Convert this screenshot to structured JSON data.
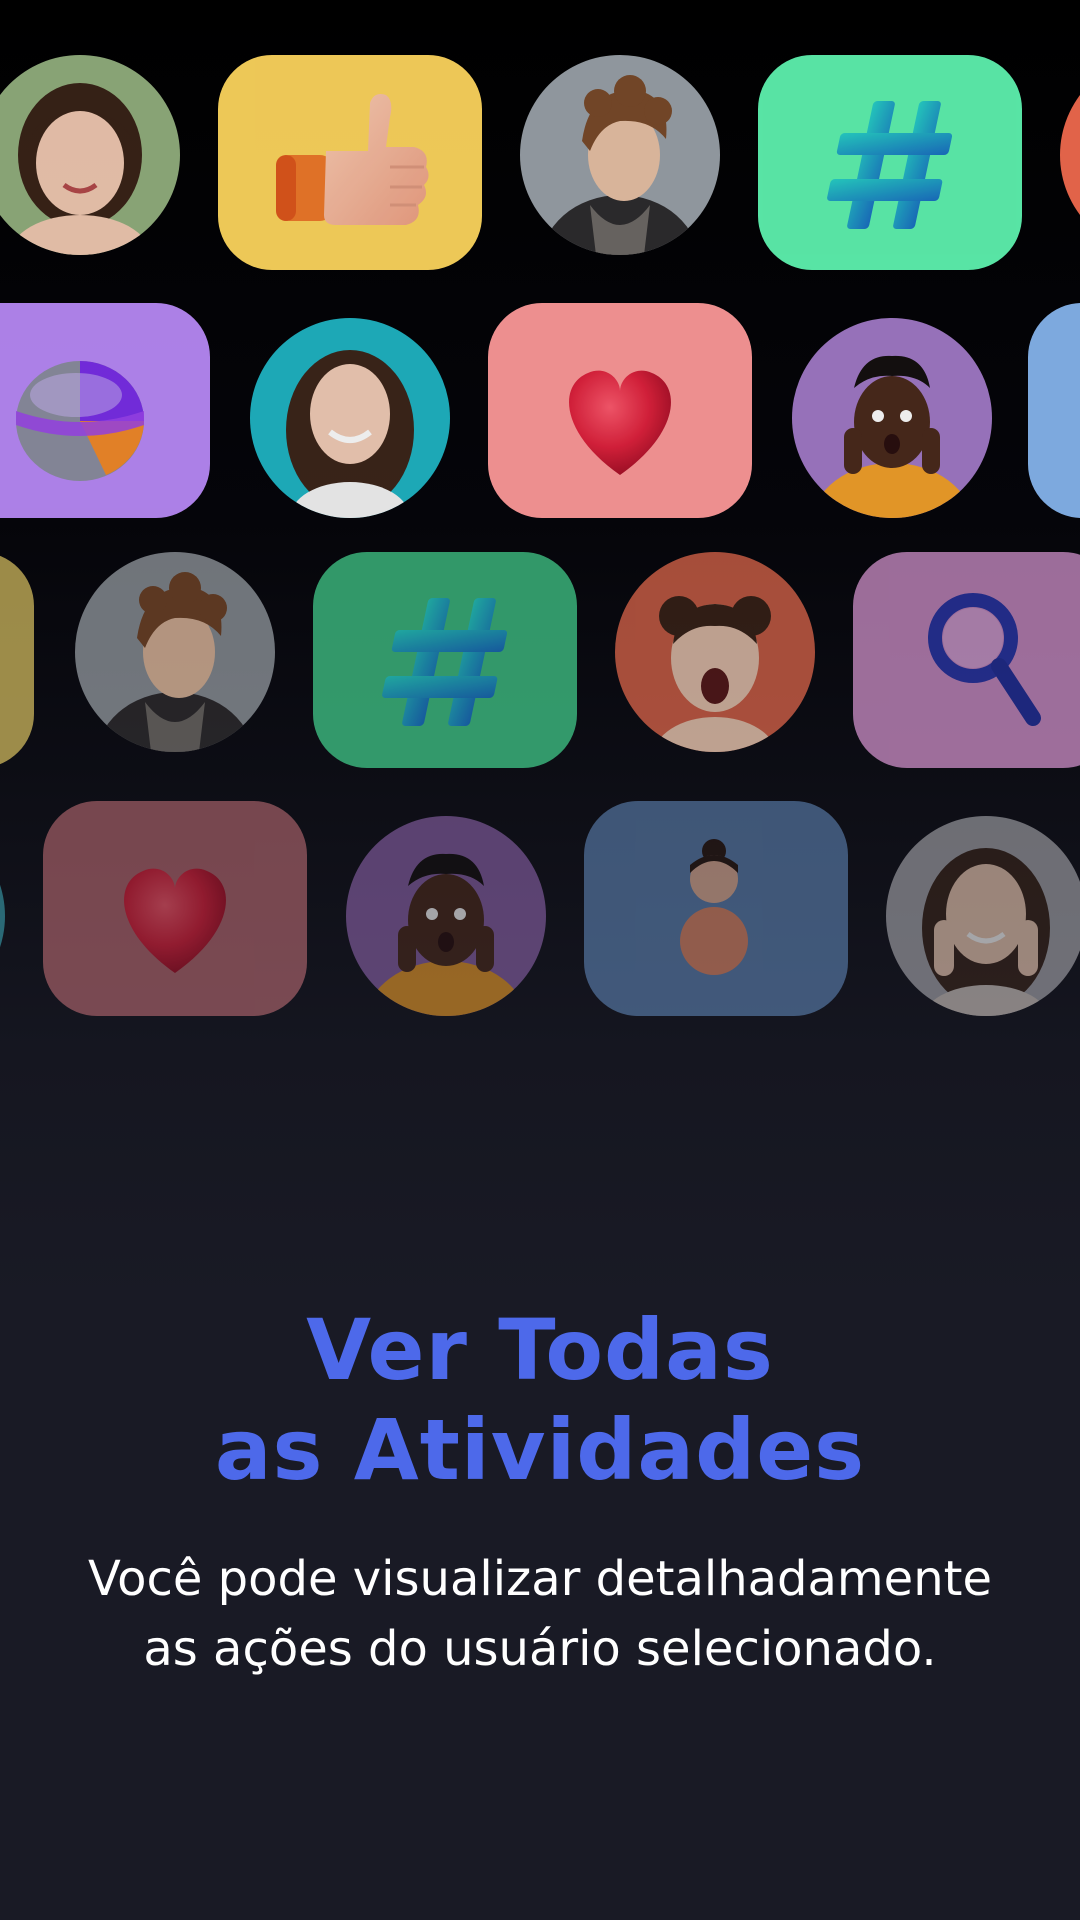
{
  "onboarding": {
    "headline_line1": "Ver Todas",
    "headline_line2": "as Atividades",
    "description_line1": "Você pode visualizar detalhadamente",
    "description_line2": "as ações do usuário selecionado."
  },
  "colors": {
    "headline": "#4d69ea",
    "description": "#ffffff",
    "background": "#191a25",
    "tile_yellow": "#ffd75e",
    "tile_green": "#5ff5b1",
    "tile_purple": "#b98af8",
    "tile_pink": "#ff9a9a",
    "tile_magenta": "#c98ac6",
    "tile_blue": "#5e83b3"
  },
  "icons": {
    "row1": [
      "avatar-woman-bob-hair",
      "thumbs-up-icon",
      "avatar-man-curly-hair",
      "hashtag-icon",
      "partial-orange-tile"
    ],
    "row2": [
      "pie-chart-icon",
      "avatar-woman-smiling",
      "heart-icon",
      "avatar-man-surprised",
      "partial-blue-tile"
    ],
    "row3": [
      "partial-yellow-tile",
      "avatar-man-curly-hair",
      "hashtag-icon",
      "avatar-woman-shouting",
      "magnifier-icon"
    ],
    "row4": [
      "partial-teal-avatar",
      "heart-icon",
      "avatar-man-surprised",
      "person-figure-icon",
      "avatar-woman-hands-face"
    ]
  }
}
